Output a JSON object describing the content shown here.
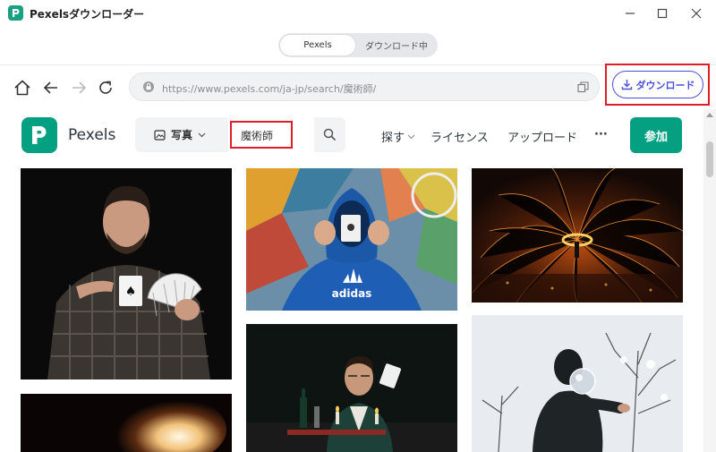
{
  "window": {
    "title": "Pexelsダウンローダー",
    "controls": [
      "minimize",
      "maximize",
      "close"
    ]
  },
  "mode_tabs": [
    {
      "label": "Pexels",
      "active": true
    },
    {
      "label": "ダウンロード中",
      "active": false
    }
  ],
  "browser": {
    "url": "https://www.pexels.com/ja-jp/search/魔術師/",
    "download_button_label": "ダウンロード",
    "nav_icons": [
      "home-icon",
      "back-icon",
      "forward-icon",
      "refresh-icon",
      "lock-icon",
      "copy-icon",
      "download-icon"
    ]
  },
  "site": {
    "brand": "Pexels",
    "search_type": "写真",
    "search_query": "魔術師",
    "nav": {
      "explore": "探す",
      "license": "ライセンス",
      "upload": "アップロード",
      "more": "···",
      "join": "参加"
    },
    "photo_text": {
      "hoodie_brand": "adidas"
    }
  },
  "colors": {
    "pexels_green": "#05a081",
    "accent_blue": "#4a4fd8",
    "highlight_red": "#e11d2a"
  }
}
